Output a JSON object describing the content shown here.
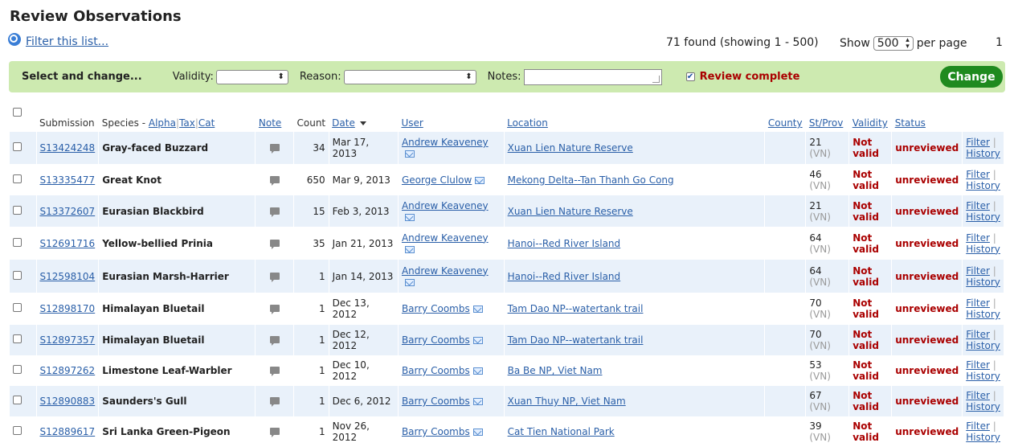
{
  "page": {
    "title": "Review Observations",
    "filter_link": "Filter this list...",
    "found_text": "71 found (showing 1 - 500)",
    "show_label": "Show",
    "per_page_value": "500",
    "per_page_label": "per page",
    "page_number": "1"
  },
  "bar": {
    "title": "Select and change...",
    "validity_label": "Validity:",
    "reason_label": "Reason:",
    "notes_label": "Notes:",
    "review_complete_label": "Review complete",
    "review_complete_checked": true,
    "change_button": "Change"
  },
  "columns": {
    "submission": "Submission",
    "species": "Species - ",
    "alpha": "Alpha",
    "tax": "Tax",
    "cat": "Cat",
    "note": "Note",
    "count": "Count",
    "date": "Date",
    "user": "User",
    "location": "Location",
    "county": "County",
    "stprov": "St/Prov",
    "validity": "Validity",
    "status": "Status"
  },
  "row_links": {
    "filter": "Filter",
    "history": "History",
    "not": "Not",
    "valid": "valid"
  },
  "rows": [
    {
      "id": "S13424248",
      "species": "Gray-faced Buzzard",
      "count": "34",
      "date": "Mar 17, 2013",
      "user": "Andrew Keaveney",
      "location": "Xuan Lien Nature Reserve",
      "stprov_num": "21",
      "stprov_cc": "(VN)",
      "status": "unreviewed"
    },
    {
      "id": "S13335477",
      "species": "Great Knot",
      "count": "650",
      "date": "Mar 9, 2013",
      "user": "George Clulow",
      "location": "Mekong Delta--Tan Thanh Go Cong",
      "stprov_num": "46",
      "stprov_cc": "(VN)",
      "status": "unreviewed"
    },
    {
      "id": "S13372607",
      "species": "Eurasian Blackbird",
      "count": "15",
      "date": "Feb 3, 2013",
      "user": "Andrew Keaveney",
      "location": "Xuan Lien Nature Reserve",
      "stprov_num": "21",
      "stprov_cc": "(VN)",
      "status": "unreviewed"
    },
    {
      "id": "S12691716",
      "species": "Yellow-bellied Prinia",
      "count": "35",
      "date": "Jan 21, 2013",
      "user": "Andrew Keaveney",
      "location": "Hanoi--Red River Island",
      "stprov_num": "64",
      "stprov_cc": "(VN)",
      "status": "unreviewed"
    },
    {
      "id": "S12598104",
      "species": "Eurasian Marsh-Harrier",
      "count": "1",
      "date": "Jan 14, 2013",
      "user": "Andrew Keaveney",
      "location": "Hanoi--Red River Island",
      "stprov_num": "64",
      "stprov_cc": "(VN)",
      "status": "unreviewed"
    },
    {
      "id": "S12898170",
      "species": "Himalayan Bluetail",
      "count": "1",
      "date": "Dec 13, 2012",
      "user": "Barry Coombs",
      "location": "Tam Dao NP--watertank trail",
      "stprov_num": "70",
      "stprov_cc": "(VN)",
      "status": "unreviewed"
    },
    {
      "id": "S12897357",
      "species": "Himalayan Bluetail",
      "count": "1",
      "date": "Dec 12, 2012",
      "user": "Barry Coombs",
      "location": "Tam Dao NP--watertank trail",
      "stprov_num": "70",
      "stprov_cc": "(VN)",
      "status": "unreviewed"
    },
    {
      "id": "S12897262",
      "species": "Limestone Leaf-Warbler",
      "count": "1",
      "date": "Dec 10, 2012",
      "user": "Barry Coombs",
      "location": "Ba Be NP, Viet Nam",
      "stprov_num": "53",
      "stprov_cc": "(VN)",
      "status": "unreviewed"
    },
    {
      "id": "S12890883",
      "species": "Saunders's Gull",
      "count": "1",
      "date": "Dec 6, 2012",
      "user": "Barry Coombs",
      "location": "Xuan Thuy NP, Viet Nam",
      "stprov_num": "67",
      "stprov_cc": "(VN)",
      "status": "unreviewed"
    },
    {
      "id": "S12889617",
      "species": "Sri Lanka Green-Pigeon",
      "count": "1",
      "date": "Nov 26, 2012",
      "user": "Barry Coombs",
      "location": "Cat Tien National Park",
      "stprov_num": "39",
      "stprov_cc": "(VN)",
      "status": "unreviewed"
    }
  ]
}
